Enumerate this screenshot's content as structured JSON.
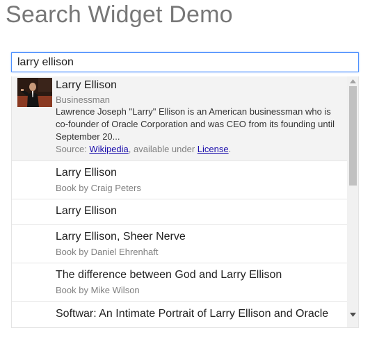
{
  "page": {
    "title": "Search Widget Demo"
  },
  "search": {
    "value": "larry ellison",
    "placeholder": ""
  },
  "top_result": {
    "title": "Larry Ellison",
    "subtitle": "Businessman",
    "description": "Lawrence Joseph \"Larry\" Ellison is an American businessman who is co-founder of Oracle Corporation and was CEO from its founding until September 20...",
    "source_prefix": "Source: ",
    "source_link": "Wikipedia",
    "source_middle": ", available under ",
    "license_link": "License",
    "source_suffix": "."
  },
  "results": [
    {
      "title": "Larry Ellison",
      "subtitle": "Book by Craig Peters"
    },
    {
      "title": "Larry Ellison",
      "subtitle": ""
    },
    {
      "title": "Larry Ellison, Sheer Nerve",
      "subtitle": "Book by Daniel Ehrenhaft"
    },
    {
      "title": "The difference between God and Larry Ellison",
      "subtitle": "Book by Mike Wilson"
    },
    {
      "title": "Softwar: An Intimate Portrait of Larry Ellison and Oracle",
      "subtitle": ""
    }
  ],
  "icons": {
    "thumbnail": "person-photo",
    "scroll_up": "triangle-up-icon",
    "scroll_down": "triangle-down-icon"
  },
  "colors": {
    "focus_border": "#4d90fe",
    "link": "#1a0dab",
    "highlight_bg": "#f3f3f3"
  }
}
